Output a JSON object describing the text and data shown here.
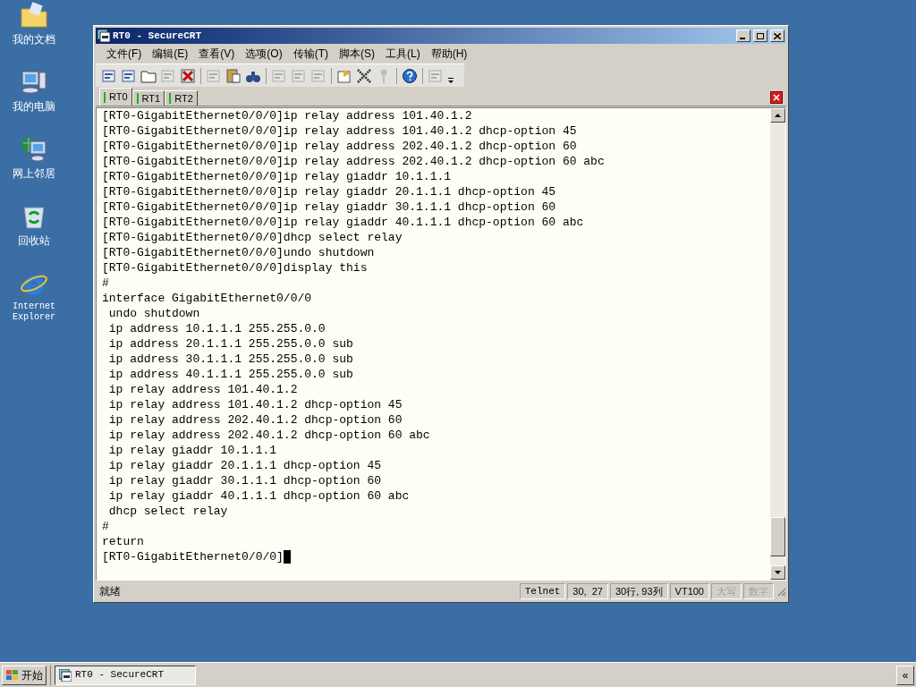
{
  "desktop_icons": [
    {
      "label": "我的文档",
      "kind": "documents"
    },
    {
      "label": "我的电脑",
      "kind": "computer"
    },
    {
      "label": "网上邻居",
      "kind": "network"
    },
    {
      "label": "回收站",
      "kind": "recycle"
    },
    {
      "label": "Internet Explorer",
      "kind": "browser"
    }
  ],
  "window": {
    "title": "RT0 - SecureCRT"
  },
  "menu": [
    "文件(F)",
    "编辑(E)",
    "查看(V)",
    "选项(O)",
    "传输(T)",
    "脚本(S)",
    "工具(L)",
    "帮助(H)"
  ],
  "toolbar": [
    [
      {
        "disabled": false
      },
      {
        "disabled": false
      },
      {
        "disabled": false
      },
      {
        "disabled": true
      },
      {
        "disabled": false
      }
    ],
    [
      {
        "disabled": true
      },
      {
        "disabled": false
      },
      {
        "disabled": false
      }
    ],
    [
      {
        "disabled": true
      },
      {
        "disabled": true
      },
      {
        "disabled": true
      }
    ],
    [
      {
        "disabled": false
      },
      {
        "disabled": false
      },
      {
        "disabled": true
      }
    ],
    [
      {
        "disabled": false
      }
    ],
    [
      {
        "disabled": true
      }
    ]
  ],
  "tabs": [
    {
      "label": "RT0",
      "selected": true
    },
    {
      "label": "RT1",
      "selected": false
    },
    {
      "label": "RT2",
      "selected": false
    }
  ],
  "terminal_lines": [
    "[RT0-GigabitEthernet0/0/0]ip relay address 101.40.1.2",
    "[RT0-GigabitEthernet0/0/0]ip relay address 101.40.1.2 dhcp-option 45",
    "[RT0-GigabitEthernet0/0/0]ip relay address 202.40.1.2 dhcp-option 60",
    "[RT0-GigabitEthernet0/0/0]ip relay address 202.40.1.2 dhcp-option 60 abc",
    "[RT0-GigabitEthernet0/0/0]ip relay giaddr 10.1.1.1",
    "[RT0-GigabitEthernet0/0/0]ip relay giaddr 20.1.1.1 dhcp-option 45",
    "[RT0-GigabitEthernet0/0/0]ip relay giaddr 30.1.1.1 dhcp-option 60",
    "[RT0-GigabitEthernet0/0/0]ip relay giaddr 40.1.1.1 dhcp-option 60 abc",
    "[RT0-GigabitEthernet0/0/0]dhcp select relay",
    "[RT0-GigabitEthernet0/0/0]undo shutdown",
    "[RT0-GigabitEthernet0/0/0]display this",
    "#",
    "interface GigabitEthernet0/0/0",
    " undo shutdown",
    " ip address 10.1.1.1 255.255.0.0",
    " ip address 20.1.1.1 255.255.0.0 sub",
    " ip address 30.1.1.1 255.255.0.0 sub",
    " ip address 40.1.1.1 255.255.0.0 sub",
    " ip relay address 101.40.1.2",
    " ip relay address 101.40.1.2 dhcp-option 45",
    " ip relay address 202.40.1.2 dhcp-option 60",
    " ip relay address 202.40.1.2 dhcp-option 60 abc",
    " ip relay giaddr 10.1.1.1",
    " ip relay giaddr 20.1.1.1 dhcp-option 45",
    " ip relay giaddr 30.1.1.1 dhcp-option 60",
    " ip relay giaddr 40.1.1.1 dhcp-option 60 abc",
    " dhcp select relay",
    "#",
    "return"
  ],
  "prompt": "[RT0-GigabitEthernet0/0/0]",
  "status_bar": {
    "message": "就绪",
    "panels": [
      {
        "text": "Telnet",
        "disabled": false
      },
      {
        "text": "30,  27",
        "disabled": false
      },
      {
        "text": "30行, 93列",
        "disabled": false
      },
      {
        "text": "VT100",
        "disabled": false
      },
      {
        "text": "大写",
        "disabled": true
      },
      {
        "text": "数字",
        "disabled": true
      }
    ]
  },
  "taskbar": {
    "start": "开始",
    "tasks": [
      {
        "label": "RT0 - SecureCRT",
        "selected": true
      }
    ],
    "tray_button": "«"
  }
}
